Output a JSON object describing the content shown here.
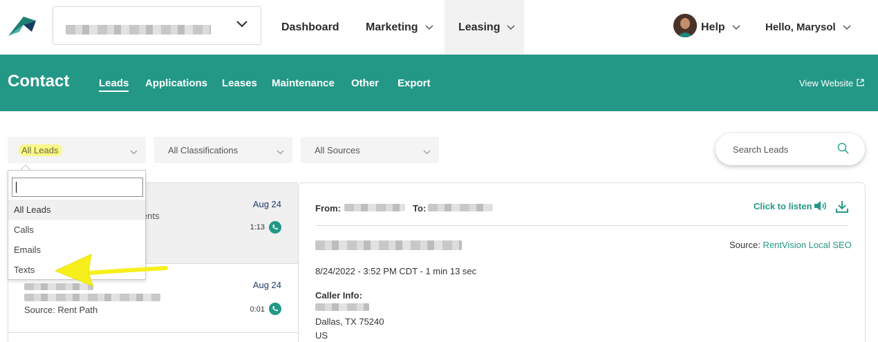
{
  "header": {
    "nav": [
      {
        "label": "Dashboard"
      },
      {
        "label": "Marketing"
      },
      {
        "label": "Leasing"
      }
    ],
    "help_label": "Help",
    "greeting": "Hello, Marysol"
  },
  "subnav": {
    "title": "Contact",
    "tabs": [
      {
        "label": "Leads"
      },
      {
        "label": "Applications"
      },
      {
        "label": "Leases"
      },
      {
        "label": "Maintenance"
      },
      {
        "label": "Other"
      },
      {
        "label": "Export"
      }
    ],
    "view_website": "View Website"
  },
  "filters": {
    "leads_type": "All Leads",
    "classifications": "All Classifications",
    "sources": "All Sources",
    "search_placeholder": "Search Leads"
  },
  "dropdown": {
    "options": [
      "All Leads",
      "Calls",
      "Emails",
      "Texts"
    ]
  },
  "leads": [
    {
      "date": "Aug 24",
      "duration": "1:13",
      "fragment": "ents"
    },
    {
      "date": "Aug 24",
      "duration": "0:01",
      "source": "Source: Rent Path"
    }
  ],
  "detail": {
    "from_label": "From:",
    "to_label": "To:",
    "listen_label": "Click to listen",
    "source_prefix": "Source:",
    "source_value": "RentVision Local SEO",
    "datetime": "8/24/2022 - 3:52 PM CDT - 1 min 13 sec",
    "caller_info_label": "Caller Info:",
    "city_line": "Dallas, TX 75240",
    "country": "US"
  },
  "colors": {
    "brand_teal": "#249887",
    "highlight_yellow": "#fbf78a",
    "arrow_yellow": "#f7ef1c"
  }
}
